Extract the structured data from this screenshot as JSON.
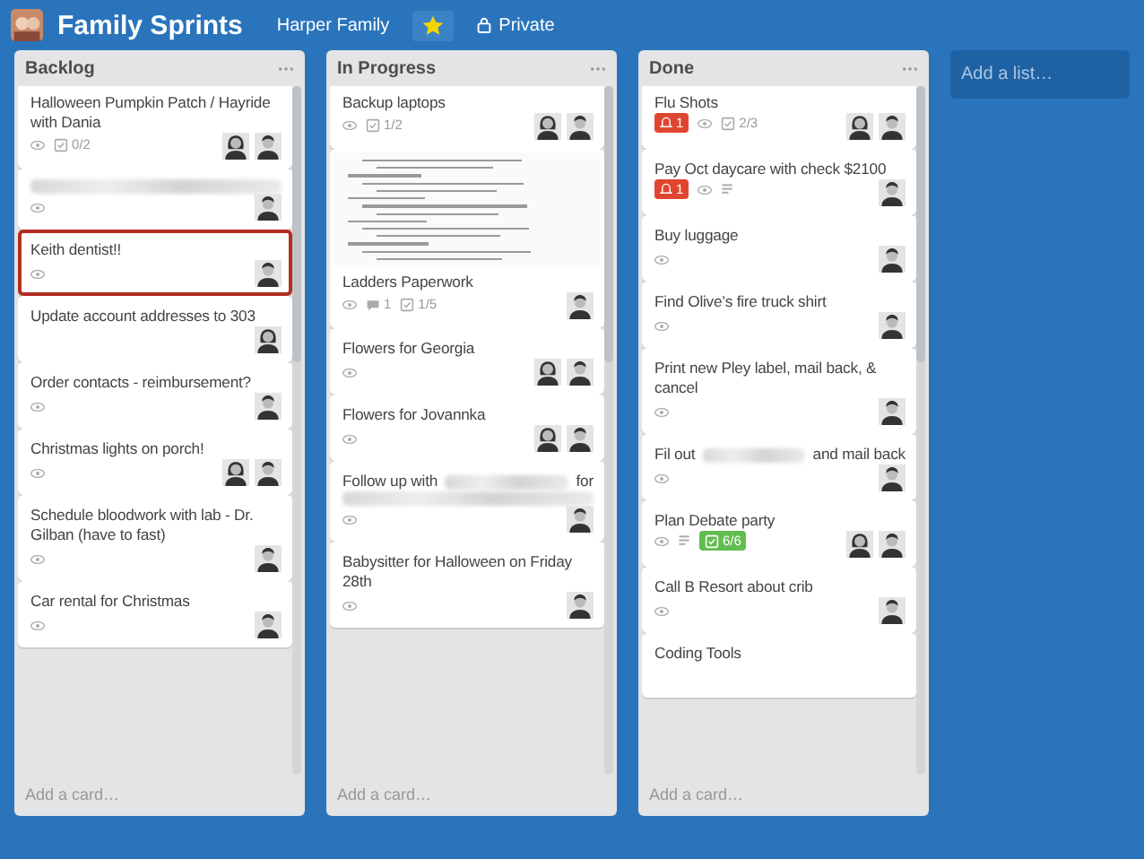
{
  "header": {
    "board_title": "Family Sprints",
    "team": "Harper Family",
    "starred": true,
    "visibility": "Private"
  },
  "lists": [
    {
      "title": "Backlog",
      "add_card": "Add a card…",
      "cards": [
        {
          "selected": false,
          "title_parts": [
            {
              "kind": "text",
              "text": "Halloween Pumpkin Patch / Hayride with Dania"
            }
          ],
          "watching": true,
          "checklist": {
            "text": "0/2",
            "complete": false
          },
          "members": [
            {
              "kind": "female"
            },
            {
              "kind": "male"
            }
          ]
        },
        {
          "selected": false,
          "title_parts": [
            {
              "kind": "redacted"
            }
          ],
          "watching": true,
          "members": [
            {
              "kind": "male"
            }
          ]
        },
        {
          "selected": true,
          "title_parts": [
            {
              "kind": "text",
              "text": "Keith dentist!!"
            }
          ],
          "watching": true,
          "members": [
            {
              "kind": "male"
            }
          ]
        },
        {
          "selected": false,
          "title_parts": [
            {
              "kind": "text",
              "text": "Update account addresses to 303"
            }
          ],
          "watching": false,
          "members": [
            {
              "kind": "female"
            }
          ]
        },
        {
          "selected": false,
          "title_parts": [
            {
              "kind": "text",
              "text": "Order contacts - reimbursement?"
            }
          ],
          "watching": true,
          "members": [
            {
              "kind": "male"
            }
          ]
        },
        {
          "selected": false,
          "title_parts": [
            {
              "kind": "text",
              "text": "Christmas lights on porch!"
            }
          ],
          "watching": true,
          "members": [
            {
              "kind": "female"
            },
            {
              "kind": "male"
            }
          ]
        },
        {
          "selected": false,
          "title_parts": [
            {
              "kind": "text",
              "text": "Schedule bloodwork with lab - Dr. Gilban (have to fast)"
            }
          ],
          "watching": true,
          "members": [
            {
              "kind": "male"
            }
          ]
        },
        {
          "selected": false,
          "title_parts": [
            {
              "kind": "text",
              "text": "Car rental for Christmas"
            }
          ],
          "watching": true,
          "members": [
            {
              "kind": "male"
            }
          ]
        }
      ]
    },
    {
      "title": "In Progress",
      "add_card": "Add a card…",
      "cards": [
        {
          "selected": false,
          "title_parts": [
            {
              "kind": "text",
              "text": "Backup laptops"
            }
          ],
          "watching": true,
          "checklist": {
            "text": "1/2",
            "complete": false
          },
          "members": [
            {
              "kind": "female"
            },
            {
              "kind": "male"
            }
          ]
        },
        {
          "selected": false,
          "cover": true,
          "title_parts": [
            {
              "kind": "text",
              "text": "Ladders Paperwork"
            }
          ],
          "watching": true,
          "comments": "1",
          "checklist": {
            "text": "1/5",
            "complete": false
          },
          "members": [
            {
              "kind": "male"
            }
          ]
        },
        {
          "selected": false,
          "title_parts": [
            {
              "kind": "text",
              "text": "Flowers for Georgia"
            }
          ],
          "watching": true,
          "members": [
            {
              "kind": "female"
            },
            {
              "kind": "male"
            }
          ]
        },
        {
          "selected": false,
          "title_parts": [
            {
              "kind": "text",
              "text": "Flowers for Jovannka"
            }
          ],
          "watching": true,
          "members": [
            {
              "kind": "female"
            },
            {
              "kind": "male"
            }
          ]
        },
        {
          "selected": false,
          "title_parts": [
            {
              "kind": "text",
              "text": "Follow up with"
            },
            {
              "kind": "redacted"
            },
            {
              "kind": "text",
              "text": "for"
            },
            {
              "kind": "redacted"
            }
          ],
          "watching": true,
          "members": [
            {
              "kind": "male"
            }
          ]
        },
        {
          "selected": false,
          "title_parts": [
            {
              "kind": "text",
              "text": "Babysitter for Halloween on Friday 28th"
            }
          ],
          "watching": true,
          "members": [
            {
              "kind": "male"
            }
          ]
        }
      ]
    },
    {
      "title": "Done",
      "add_card": "Add a card…",
      "cards": [
        {
          "selected": false,
          "title_parts": [
            {
              "kind": "text",
              "text": "Flu Shots"
            }
          ],
          "notifications": "1",
          "watching": true,
          "checklist": {
            "text": "2/3",
            "complete": false
          },
          "members": [
            {
              "kind": "female"
            },
            {
              "kind": "male"
            }
          ]
        },
        {
          "selected": false,
          "title_parts": [
            {
              "kind": "text",
              "text": "Pay Oct daycare with check $2100"
            }
          ],
          "notifications": "1",
          "watching": true,
          "description": true,
          "members": [
            {
              "kind": "male"
            }
          ]
        },
        {
          "selected": false,
          "title_parts": [
            {
              "kind": "text",
              "text": "Buy luggage"
            }
          ],
          "watching": true,
          "members": [
            {
              "kind": "male"
            }
          ]
        },
        {
          "selected": false,
          "title_parts": [
            {
              "kind": "text",
              "text": "Find Olive’s fire truck shirt"
            }
          ],
          "watching": true,
          "members": [
            {
              "kind": "male"
            }
          ]
        },
        {
          "selected": false,
          "title_parts": [
            {
              "kind": "text",
              "text": "Print new Pley label, mail back, & cancel"
            }
          ],
          "watching": true,
          "members": [
            {
              "kind": "male"
            }
          ]
        },
        {
          "selected": false,
          "title_parts": [
            {
              "kind": "text",
              "text": "Fil out"
            },
            {
              "kind": "redacted"
            },
            {
              "kind": "text",
              "text": "and mail back"
            }
          ],
          "watching": true,
          "members": [
            {
              "kind": "male"
            }
          ]
        },
        {
          "selected": false,
          "title_parts": [
            {
              "kind": "text",
              "text": "Plan Debate party"
            }
          ],
          "watching": true,
          "description": true,
          "checklist": {
            "text": "6/6",
            "complete": true
          },
          "members": [
            {
              "kind": "female"
            },
            {
              "kind": "male"
            }
          ]
        },
        {
          "selected": false,
          "title_parts": [
            {
              "kind": "text",
              "text": "Call B Resort about crib"
            }
          ],
          "watching": true,
          "members": [
            {
              "kind": "male"
            }
          ]
        },
        {
          "selected": false,
          "title_parts": [
            {
              "kind": "text",
              "text": "Coding Tools"
            }
          ],
          "watching": false
        }
      ]
    }
  ],
  "add_list": "Add a list…"
}
